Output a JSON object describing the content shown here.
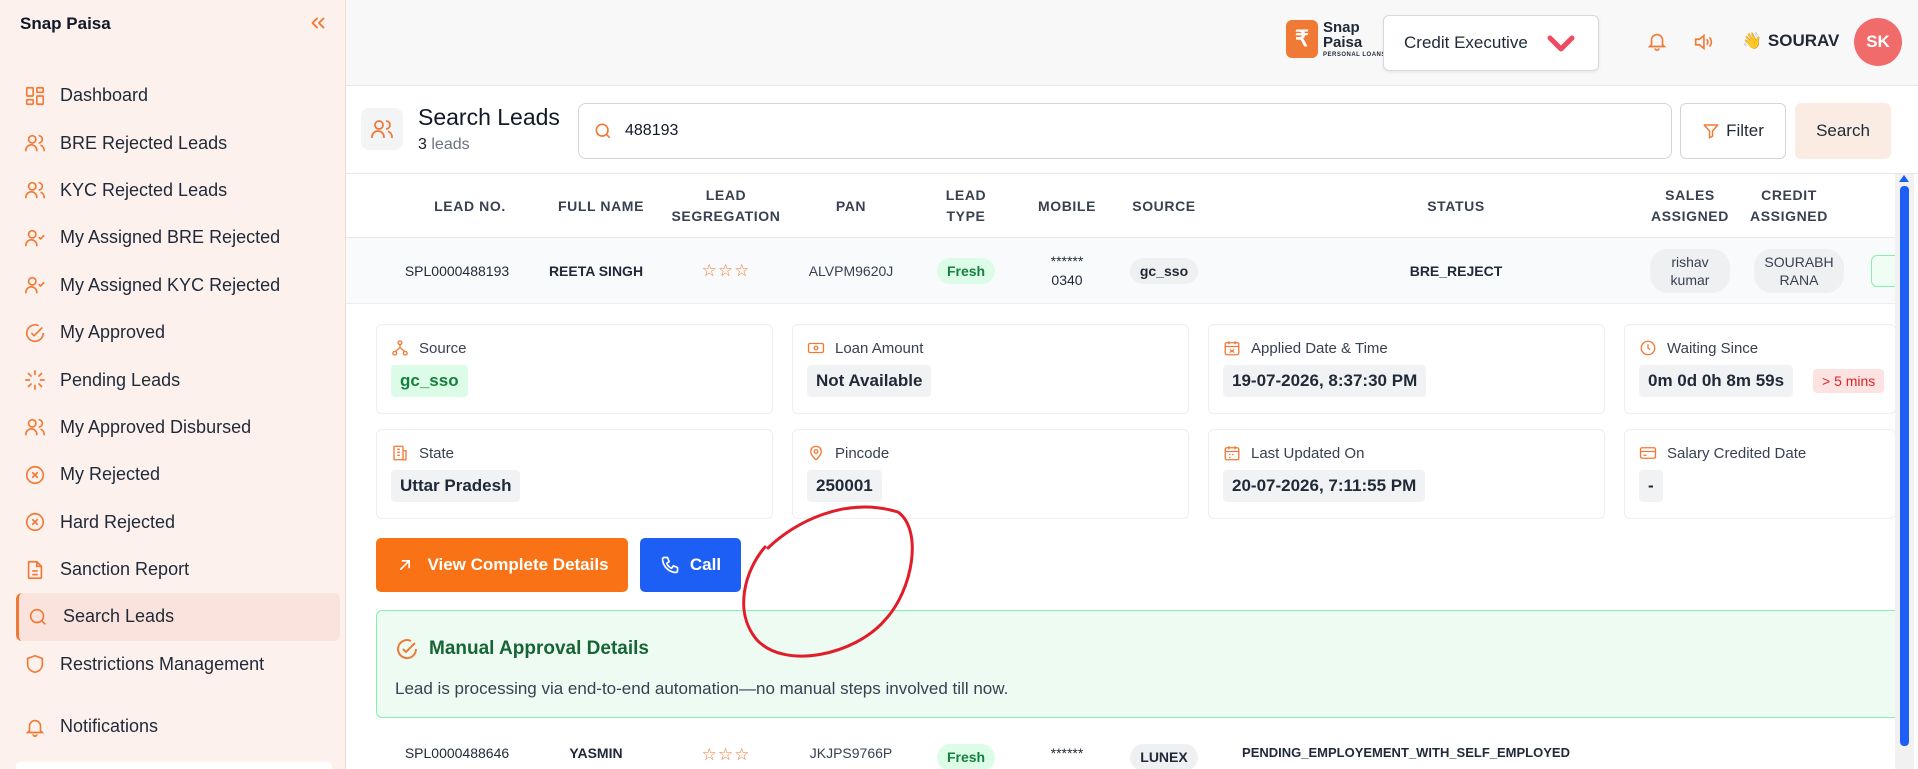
{
  "app": {
    "brand": "Snap Paisa"
  },
  "sidebar": {
    "items": [
      {
        "label": "Dashboard",
        "icon": "dashboard-icon"
      },
      {
        "label": "BRE Rejected Leads",
        "icon": "users-icon"
      },
      {
        "label": "KYC Rejected Leads",
        "icon": "users-icon"
      },
      {
        "label": "My Assigned BRE Rejected",
        "icon": "user-check-icon"
      },
      {
        "label": "My Assigned KYC Rejected",
        "icon": "user-check-icon"
      },
      {
        "label": "My Approved",
        "icon": "check-circle-icon"
      },
      {
        "label": "Pending Leads",
        "icon": "loader-icon"
      },
      {
        "label": "My Approved Disbursed",
        "icon": "users-icon"
      },
      {
        "label": "My Rejected",
        "icon": "x-circle-icon"
      },
      {
        "label": "Hard Rejected",
        "icon": "x-circle-icon"
      },
      {
        "label": "Sanction Report",
        "icon": "file-icon"
      },
      {
        "label": "Search Leads",
        "icon": "search-icon",
        "active": true
      },
      {
        "label": "Restrictions Management",
        "icon": "shield-icon"
      },
      {
        "label": "Notifications",
        "icon": "bell-icon"
      }
    ]
  },
  "topbar": {
    "logo_line1": "Snap",
    "logo_line2": "Paisa",
    "logo_line3": "PERSONAL LOANS",
    "role": "Credit Executive",
    "user_name": "SOURAV",
    "avatar_initials": "SK"
  },
  "search": {
    "title": "Search Leads",
    "count": "3",
    "count_label": "leads",
    "query": "488193",
    "filter_label": "Filter",
    "search_label": "Search"
  },
  "table": {
    "headers": [
      "LEAD NO.",
      "FULL NAME",
      "LEAD SEGREGATION",
      "PAN",
      "LEAD TYPE",
      "MOBILE",
      "SOURCE",
      "STATUS",
      "SALES ASSIGNED",
      "CREDIT ASSIGNED"
    ],
    "rows": [
      {
        "lead_no": "SPL0000488193",
        "name": "REETA SINGH",
        "stars": "☆☆☆",
        "pan": "ALVPM9620J",
        "lead_type": "Fresh",
        "mobile_line1": "******",
        "mobile_line2": "0340",
        "source": "gc_sso",
        "status": "BRE_REJECT",
        "sales_assigned": "rishav kumar",
        "credit_assigned": "SOURABH RANA"
      },
      {
        "lead_no": "SPL0000488646",
        "name": "YASMIN",
        "stars": "☆☆☆",
        "pan": "JKJPS9766P",
        "lead_type": "Fresh",
        "mobile_line1": "******",
        "source": "LUNEX",
        "status": "PENDING_EMPLOYEMENT_WITH_SELF_EMPLOYED"
      }
    ]
  },
  "details": {
    "source_label": "Source",
    "source_value": "gc_sso",
    "loan_label": "Loan Amount",
    "loan_value": "Not Available",
    "applied_label": "Applied Date & Time",
    "applied_value": "19-07-2026, 8:37:30 PM",
    "waiting_label": "Waiting Since",
    "waiting_value": "0m 0d 0h 8m 59s",
    "waiting_badge": "> 5 mins",
    "state_label": "State",
    "state_value": "Uttar Pradesh",
    "pincode_label": "Pincode",
    "pincode_value": "250001",
    "updated_label": "Last Updated On",
    "updated_value": "20-07-2026, 7:11:55 PM",
    "salary_label": "Salary Credited Date",
    "salary_value": "-"
  },
  "actions": {
    "view_label": "View Complete Details",
    "call_label": "Call"
  },
  "approval": {
    "title": "Manual Approval Details",
    "desc": "Lead is processing via end-to-end automation—no manual steps involved till now."
  },
  "colors": {
    "accent": "#f07a35",
    "primary_blue": "#1d5ff5",
    "success": "#15803d",
    "danger": "#dc2626",
    "annotation": "#e11d2a"
  }
}
